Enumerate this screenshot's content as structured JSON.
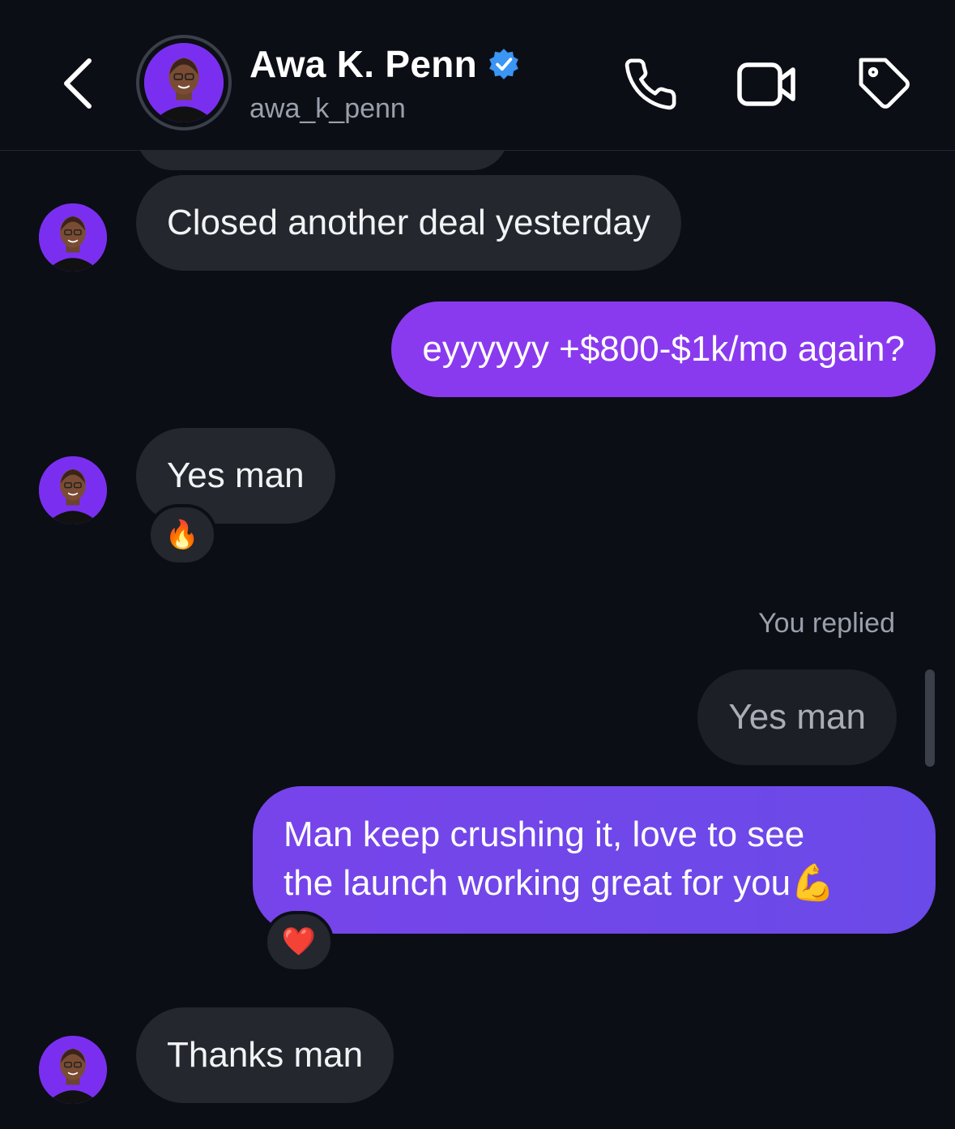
{
  "header": {
    "name": "Awa K. Penn",
    "handle": "awa_k_penn",
    "verified": true,
    "icons": [
      "chevron-left-icon",
      "phone-icon",
      "video-icon",
      "tag-icon"
    ]
  },
  "colors": {
    "background": "#0b0e15",
    "incoming_bubble": "#24272e",
    "outgoing_gradient_start": "#8b3bef",
    "outgoing_gradient_end": "#6a4ae8",
    "verified_badge": "#3b95f3"
  },
  "messages": [
    {
      "from": "them",
      "text": "Closed another deal yesterday"
    },
    {
      "from": "me",
      "text": "eyyyyyy +$800-$1k/mo again?"
    },
    {
      "from": "them",
      "text": "Yes man",
      "reaction": "🔥"
    },
    {
      "from": "me",
      "reply_label": "You replied",
      "quoted": "Yes man",
      "lines": [
        "Man keep crushing it, love to see",
        "the launch working great for you💪"
      ],
      "reaction": "❤️"
    },
    {
      "from": "them",
      "text": "Thanks man"
    }
  ]
}
